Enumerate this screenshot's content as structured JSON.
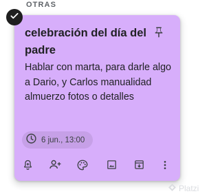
{
  "section": {
    "label": "OTRAS"
  },
  "note": {
    "title": "celebración del día del padre",
    "body": "Hablar con marta, para darle algo a Dario, y Carlos manualidad almuerzo fotos o detalles",
    "color": "#d7aefb",
    "selected": true,
    "pinned": false,
    "reminder": {
      "icon": "clock-icon",
      "text": "6 jun., 13:00"
    },
    "toolbar": [
      {
        "name": "remind-me-button",
        "icon": "bell-plus-icon"
      },
      {
        "name": "collaborator-button",
        "icon": "person-add-icon"
      },
      {
        "name": "background-options-button",
        "icon": "palette-icon"
      },
      {
        "name": "add-image-button",
        "icon": "image-icon"
      },
      {
        "name": "archive-button",
        "icon": "archive-icon"
      },
      {
        "name": "more-button",
        "icon": "more-vert-icon"
      }
    ]
  },
  "watermark": {
    "text": "Platzi"
  }
}
